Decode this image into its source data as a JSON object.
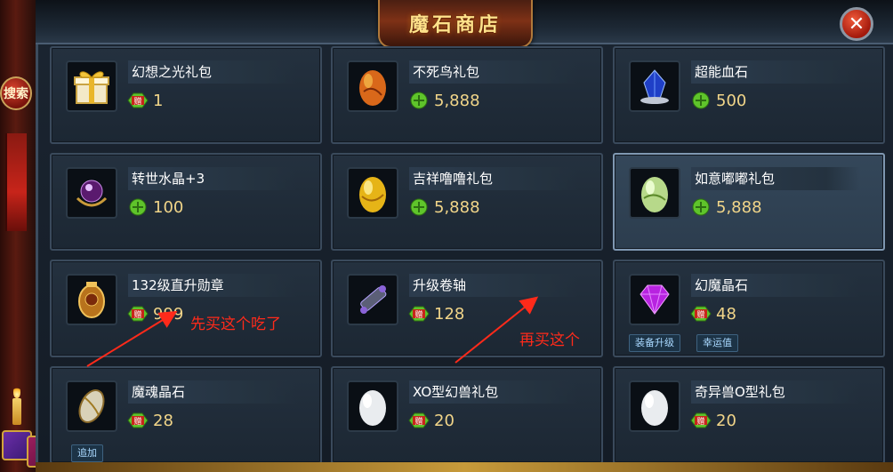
{
  "sidebar": {
    "search_label": "搜索"
  },
  "header": {
    "title": "魔石商店",
    "close_glyph": "✕"
  },
  "currency_badge_text": "赠",
  "items": [
    {
      "name": "幻想之光礼包",
      "price": "1",
      "currency": "gift-jade",
      "icon": "gold-gift-box-icon"
    },
    {
      "name": "不死鸟礼包",
      "price": "5,888",
      "currency": "jade",
      "icon": "orange-egg-icon"
    },
    {
      "name": "超能血石",
      "price": "500",
      "currency": "jade",
      "icon": "blue-blood-stone-icon"
    },
    {
      "name": "转世水晶+3",
      "price": "100",
      "currency": "jade",
      "icon": "purple-crystal-orb-icon"
    },
    {
      "name": "吉祥噜噜礼包",
      "price": "5,888",
      "currency": "jade",
      "icon": "yellow-egg-icon"
    },
    {
      "name": "如意嘟嘟礼包",
      "price": "5,888",
      "currency": "jade",
      "icon": "green-egg-icon"
    },
    {
      "name": "132级直升勋章",
      "price": "999",
      "currency": "gift-jade",
      "icon": "gold-medal-icon"
    },
    {
      "name": "升级卷轴",
      "price": "128",
      "currency": "gift-jade",
      "icon": "scroll-icon"
    },
    {
      "name": "幻魔晶石",
      "price": "48",
      "currency": "gift-jade",
      "icon": "purple-gem-icon",
      "buttons": [
        "装备升级",
        "幸运值"
      ]
    },
    {
      "name": "魔魂晶石",
      "price": "28",
      "currency": "gift-jade",
      "icon": "spirit-crystal-icon",
      "buttons": [
        "追加"
      ]
    },
    {
      "name": "XO型幻兽礼包",
      "price": "20",
      "currency": "gift-jade",
      "icon": "white-egg-icon"
    },
    {
      "name": "奇异兽O型礼包",
      "price": "20",
      "currency": "gift-jade",
      "icon": "white-egg-icon"
    }
  ],
  "annotations": {
    "first": "先买这个吃了",
    "second": "再买这个"
  },
  "colors": {
    "annotation": "#ff2a1a",
    "price": "#f1d589",
    "title": "#ffe28a"
  }
}
